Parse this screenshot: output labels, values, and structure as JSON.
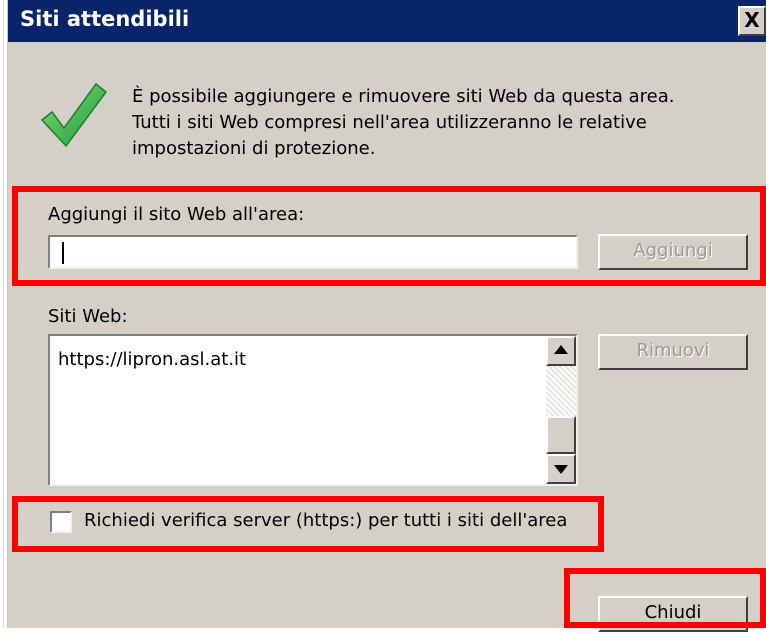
{
  "window": {
    "title": "Siti attendibili",
    "close_glyph": "X"
  },
  "info": {
    "icon": "checkmark-icon",
    "lines": [
      "È possibile aggiungere e rimuovere siti Web da questa area.",
      "Tutti i siti Web compresi nell'area utilizzeranno le relative",
      "impostazioni di protezione."
    ]
  },
  "add_site": {
    "label": "Aggiungi il sito Web all'area:",
    "value": "",
    "button": "Aggiungi"
  },
  "sites": {
    "label": "Siti Web:",
    "items": [
      "https://lipron.asl.at.it"
    ],
    "remove_button": "Rimuovi"
  },
  "https_check": {
    "label": "Richiedi verifica server (https:) per tutti i siti dell'area",
    "checked": false
  },
  "close_button": "Chiudi",
  "colors": {
    "title_bar": "#0a246a",
    "dialog_bg": "#d4d0c8",
    "highlight": "#ff0000",
    "check_green": "#3cb54a"
  }
}
